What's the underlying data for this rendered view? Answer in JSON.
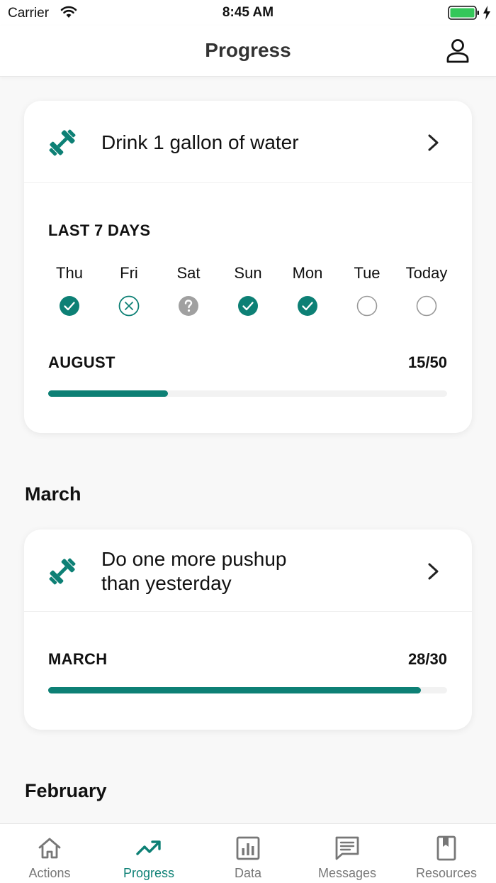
{
  "status_bar": {
    "carrier": "Carrier",
    "time": "8:45 AM"
  },
  "nav": {
    "title": "Progress"
  },
  "current_card": {
    "title": "Drink 1 gallon of water",
    "icon": "dumbbell-icon",
    "last7_label": "LAST 7 DAYS",
    "days": [
      {
        "label": "Thu",
        "status": "done"
      },
      {
        "label": "Fri",
        "status": "missed"
      },
      {
        "label": "Sat",
        "status": "unknown"
      },
      {
        "label": "Sun",
        "status": "done"
      },
      {
        "label": "Mon",
        "status": "done"
      },
      {
        "label": "Tue",
        "status": "pending"
      },
      {
        "label": "Today",
        "status": "pending"
      }
    ],
    "month_label": "AUGUST",
    "count": "15/50",
    "progress": 0.3
  },
  "sections": [
    {
      "month": "March",
      "card": {
        "title_line1": "Do one more pushup",
        "title_line2": "than yesterday",
        "icon": "dumbbell-icon",
        "month_label": "MARCH",
        "count": "28/30",
        "progress": 0.935
      }
    },
    {
      "month": "February"
    }
  ],
  "tabs": [
    {
      "label": "Actions",
      "icon": "home-icon",
      "active": false
    },
    {
      "label": "Progress",
      "icon": "trend-up-icon",
      "active": true
    },
    {
      "label": "Data",
      "icon": "bar-chart-icon",
      "active": false
    },
    {
      "label": "Messages",
      "icon": "message-icon",
      "active": false
    },
    {
      "label": "Resources",
      "icon": "bookmark-icon",
      "active": false
    }
  ],
  "colors": {
    "accent": "#0d8075",
    "unknown": "#a0a0a0",
    "inactive_tab": "#777777"
  }
}
